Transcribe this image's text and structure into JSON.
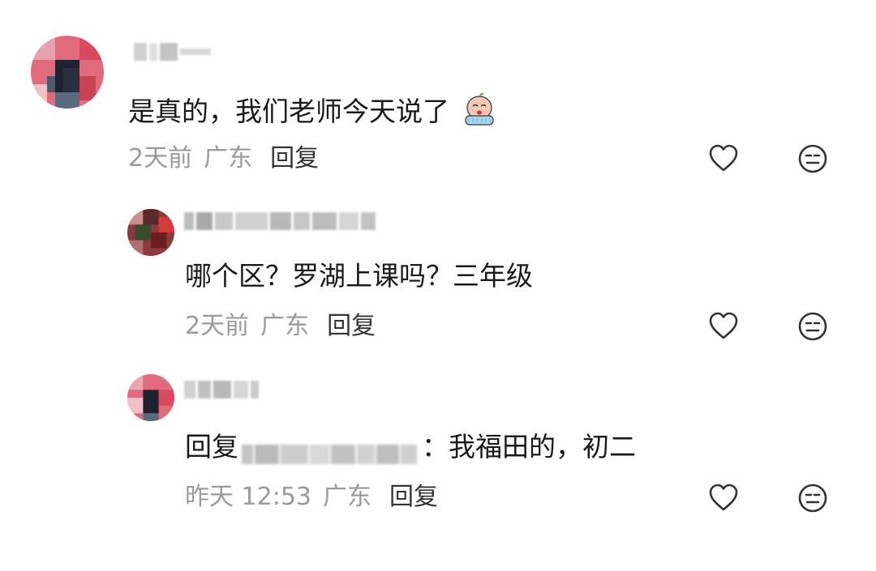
{
  "comments": [
    {
      "text": "是真的，我们老师今天说了",
      "emoji_icon": "crying-peach-emoji-icon",
      "time": "2天前",
      "location": "广东",
      "reply_label": "回复"
    },
    {
      "text": "哪个区？罗湖上课吗？三年级",
      "time": "2天前",
      "location": "广东",
      "reply_label": "回复"
    },
    {
      "reply_prefix": "回复",
      "text": "：我福田的，初二",
      "time": "昨天 12:53",
      "location": "广东",
      "reply_label": "回复"
    }
  ],
  "icons": {
    "like": "heart-icon",
    "emoji": "neutral-face-icon"
  },
  "colors": {
    "text": "#1a1a1a",
    "meta": "#9a9a9a",
    "icon": "#333333",
    "avatar_accent": "#d84a5e"
  }
}
